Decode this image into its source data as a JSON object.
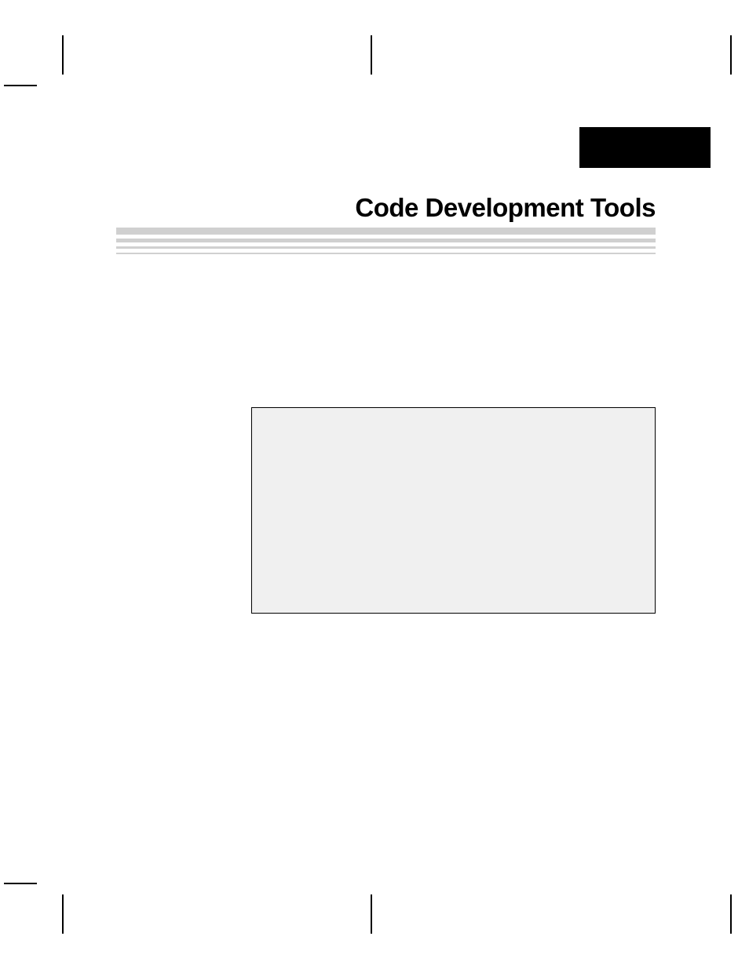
{
  "chapter": {
    "title": "Code Development Tools"
  }
}
